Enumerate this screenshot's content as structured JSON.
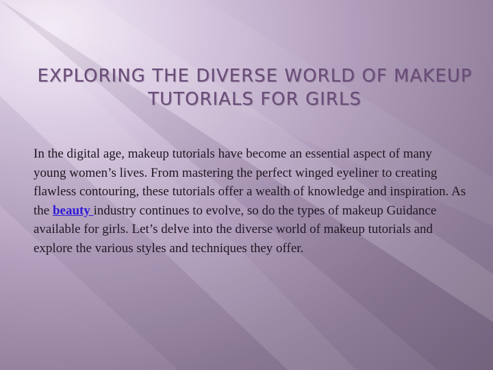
{
  "slide": {
    "title": "EXPLORING THE DIVERSE WORLD OF MAKEUP TUTORIALS FOR GIRLS",
    "paragraph_before_link": "In the digital age, makeup tutorials have become an essential aspect of many young women’s lives. From mastering the perfect winged eyeliner to creating flawless contouring, these tutorials offer a wealth of knowledge and inspiration. As the ",
    "link_text": "beauty ",
    "paragraph_after_link": "industry continues to evolve, so do the types of makeup Guidance available for girls. Let’s delve into the diverse world of makeup tutorials and explore the various styles and techniques they offer."
  },
  "colors": {
    "title": "#6a4c79",
    "body_text": "#1f1622",
    "link": "#2f1ad6",
    "background_light": "#f2eaf6",
    "background_dark": "#7a6a84"
  }
}
